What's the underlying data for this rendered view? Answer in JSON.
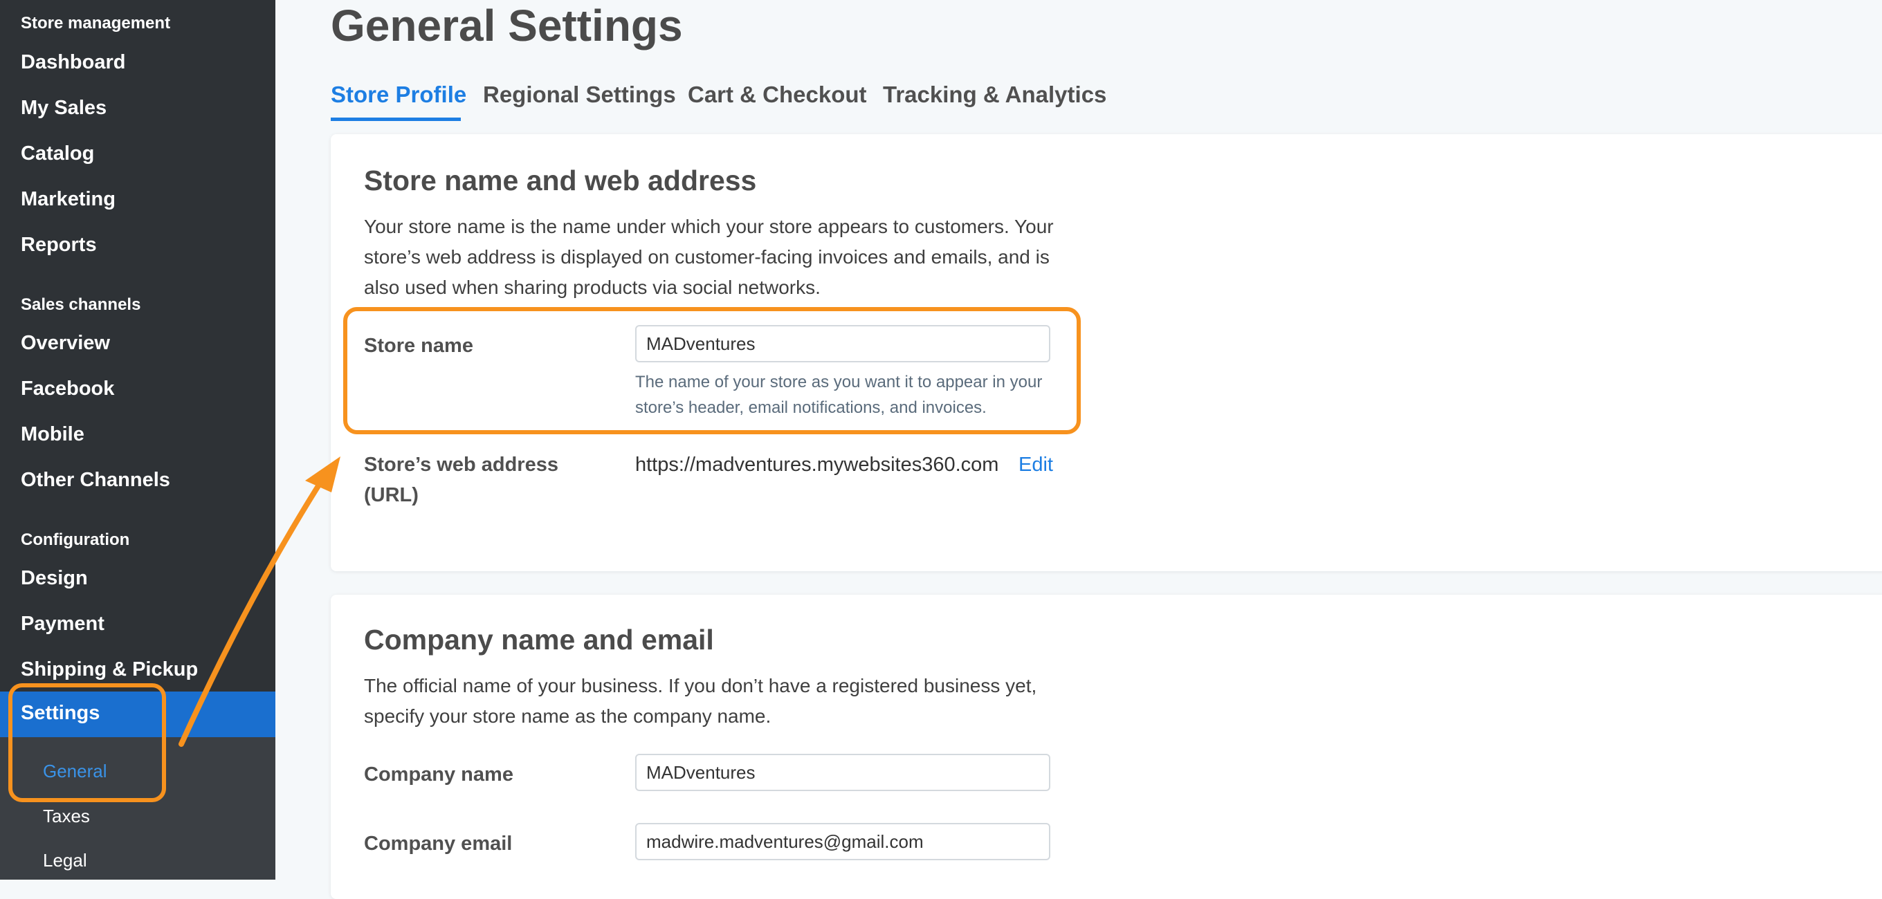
{
  "sidebar": {
    "groups": {
      "store_management": "Store management",
      "sales_channels": "Sales channels",
      "configuration": "Configuration"
    },
    "items": {
      "dashboard": "Dashboard",
      "my_sales": "My Sales",
      "catalog": "Catalog",
      "marketing": "Marketing",
      "reports": "Reports",
      "overview": "Overview",
      "facebook": "Facebook",
      "mobile": "Mobile",
      "other_channels": "Other Channels",
      "design": "Design",
      "payment": "Payment",
      "shipping_pickup": "Shipping & Pickup",
      "settings": "Settings"
    },
    "sub_items": {
      "general": "General",
      "taxes": "Taxes",
      "legal": "Legal"
    }
  },
  "page": {
    "title": "General Settings",
    "tabs": [
      "Store Profile",
      "Regional Settings",
      "Cart & Checkout",
      "Tracking & Analytics"
    ],
    "active_tab": "Store Profile"
  },
  "store_card": {
    "title": "Store name and web address",
    "description": "Your store name is the name under which your store appears to customers. Your store’s web address is displayed on customer-facing invoices and emails, and is also used when sharing products via social networks.",
    "store_name_label": "Store name",
    "store_name_value": "MADventures",
    "store_name_hint": "The name of your store as you want it to appear in your store’s header, email notifications, and invoices.",
    "web_address_label": "Store’s web address (URL)",
    "web_address_value": "https://madventures.mywebsites360.com",
    "edit_label": "Edit"
  },
  "company_card": {
    "title": "Company name and email",
    "description": "The official name of your business. If you don’t have a registered business yet, specify your store name as the company name.",
    "company_name_label": "Company name",
    "company_name_value": "MADventures",
    "company_email_label": "Company email",
    "company_email_value": "madwire.madventures@gmail.com"
  },
  "colors": {
    "accent": "#1d7ee3",
    "sidebar_bg": "#2e3236",
    "sidebar_active": "#1a6fcf",
    "annotation": "#f7921e"
  }
}
